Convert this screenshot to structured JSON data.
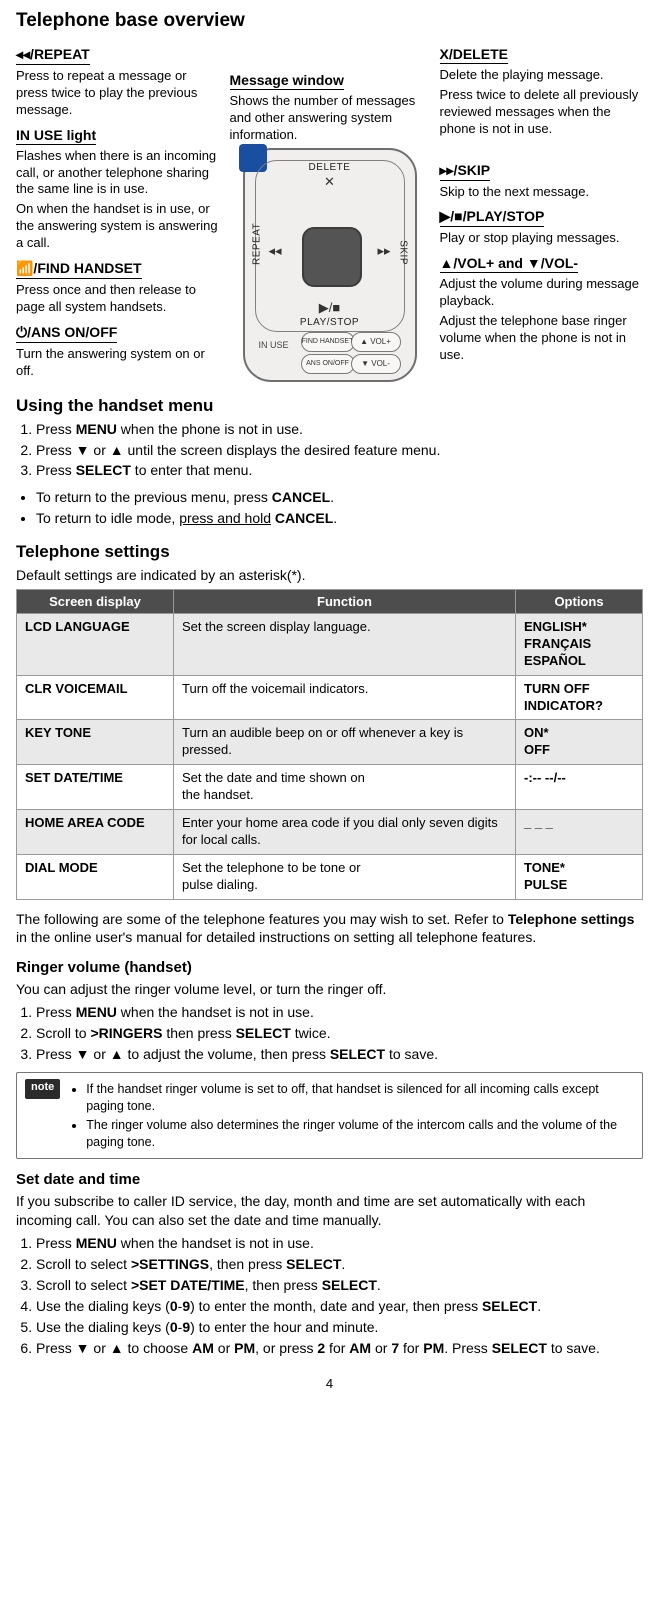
{
  "page_number": "4",
  "title": "Telephone base overview",
  "overview": {
    "left": {
      "repeat": {
        "title": "◂◂/REPEAT",
        "text": "Press to repeat a message or press twice to play the previous message."
      },
      "inuse": {
        "title": "IN USE light",
        "text1": "Flashes when there is an incoming call, or another telephone sharing the same line is in use.",
        "text2": "On when the handset is in use, or the answering system is answering a call."
      },
      "find": {
        "title": "📶/FIND HANDSET",
        "text": "Press once and then release to page all system handsets."
      },
      "ans": {
        "title": "⏻/ANS ON/OFF",
        "text": "Turn the answering system on or off."
      }
    },
    "center": {
      "msgwin": {
        "title": "Message window",
        "text": "Shows the number of messages and other answering system information."
      },
      "labels": {
        "delete": "DELETE",
        "repeat": "REPEAT",
        "skip": "SKIP",
        "play": "PLAY/STOP",
        "inuse": "IN USE",
        "find": "FIND\nHANDSET",
        "ans": "ANS\nON/OFF",
        "vplus": "▲ VOL+",
        "vminus": "▼ VOL-",
        "x": "✕",
        "left": "◂◂",
        "right": "▸▸",
        "playicon": "▶/■"
      }
    },
    "right": {
      "xdel": {
        "title": "X/DELETE",
        "text1": "Delete the playing message.",
        "text2": "Press twice to delete all previously reviewed messages when the phone is not in use."
      },
      "skip": {
        "title": "▸▸/SKIP",
        "text": "Skip to the next message."
      },
      "playstop": {
        "title": "▶/■/PLAY/STOP",
        "text": "Play or stop playing messages."
      },
      "vol": {
        "title": "▲/VOL+ and ▼/VOL-",
        "text1": "Adjust the volume during message playback.",
        "text2": "Adjust the telephone base ringer volume when the phone is not in use."
      }
    }
  },
  "using_menu": {
    "title": "Using the handset menu",
    "steps": [
      {
        "pre": "Press ",
        "bold": "MENU",
        "post": " when the phone is not in use."
      },
      {
        "pre": "Press ▼ or ▲ until the screen displays the desired feature menu.",
        "bold": "",
        "post": ""
      },
      {
        "pre": "Press ",
        "bold": "SELECT",
        "post": " to enter that menu."
      }
    ],
    "bullets": [
      {
        "pre": "To return to the previous menu, press ",
        "bold": "CANCEL",
        "post": "."
      },
      {
        "pre": "To return to idle mode, ",
        "u": "press and hold",
        "bold": " CANCEL",
        "post": "."
      }
    ]
  },
  "telephone_settings": {
    "title": "Telephone settings",
    "subtitle": "Default settings are indicated by an asterisk(*).",
    "headers": {
      "c1": "Screen display",
      "c2": "Function",
      "c3": "Options"
    },
    "rows": [
      {
        "c1": "LCD LANGUAGE",
        "c2": "Set the screen display language.",
        "c3": "ENGLISH*\nFRANÇAIS\nESPAÑOL"
      },
      {
        "c1": "CLR VOICEMAIL",
        "c2": "Turn off the voicemail indicators.",
        "c3": "TURN OFF INDICATOR?"
      },
      {
        "c1": "KEY TONE",
        "c2": "Turn an audible beep on or off whenever a key is pressed.",
        "c3": "ON*\nOFF"
      },
      {
        "c1": "SET DATE/TIME",
        "c2": "Set the date and time shown on\nthe handset.",
        "c3": "-:-- --/--"
      },
      {
        "c1": "HOME AREA CODE",
        "c2": "Enter your home area code if you dial only seven digits for local calls.",
        "c3": "_ _ _"
      },
      {
        "c1": "DIAL MODE",
        "c2": "Set the telephone to be tone or\npulse dialing.",
        "c3": "TONE*\nPULSE"
      }
    ],
    "after": {
      "p1": "The following are some of the telephone features you may wish to set. Refer to ",
      "b": "Telephone settings",
      "p2": " in the online user's manual for detailed instructions on setting all telephone features."
    }
  },
  "ringer": {
    "title": "Ringer volume (handset)",
    "intro": "You can adjust the ringer volume level, or turn the ringer off.",
    "steps": [
      {
        "pre": "Press ",
        "b": "MENU",
        "post": " when the handset is not in use."
      },
      {
        "pre": "Scroll to ",
        "b": ">RINGERS",
        "mid": " then press ",
        "b2": "SELECT",
        "post": " twice."
      },
      {
        "pre": "Press ▼ or ▲ to adjust the volume, then press ",
        "b": "SELECT",
        "post": " to save."
      }
    ],
    "note_label": "note",
    "notes": [
      "If the handset ringer volume is set to off, that handset is silenced for all incoming calls except paging tone.",
      "The ringer volume also determines the ringer volume of the intercom calls and the volume of the paging tone."
    ]
  },
  "datetime": {
    "title": "Set date and time",
    "intro": "If you subscribe to caller ID service, the day, month and time are set automatically with each incoming call. You can also set the date and time manually.",
    "steps": [
      "Press MENU when the handset is not in use.",
      "Scroll to select >SETTINGS, then press SELECT.",
      "Scroll to select >SET DATE/TIME, then press SELECT.",
      "Use the dialing keys (0-9) to enter the month, date and year, then press SELECT.",
      "Use the dialing keys (0-9) to enter the hour and minute.",
      "Press ▼ or ▲ to choose AM or PM, or press 2 for AM or 7 for PM. Press SELECT to save."
    ],
    "steps_html": [
      {
        "parts": [
          {
            "t": "Press "
          },
          {
            "b": "MENU"
          },
          {
            "t": " when the handset is not in use."
          }
        ]
      },
      {
        "parts": [
          {
            "t": "Scroll to select "
          },
          {
            "b": ">SETTINGS"
          },
          {
            "t": ", then press "
          },
          {
            "b": "SELECT"
          },
          {
            "t": "."
          }
        ]
      },
      {
        "parts": [
          {
            "t": "Scroll to select "
          },
          {
            "b": ">SET DATE/TIME"
          },
          {
            "t": ", then press "
          },
          {
            "b": "SELECT"
          },
          {
            "t": "."
          }
        ]
      },
      {
        "parts": [
          {
            "t": "Use the dialing keys ("
          },
          {
            "b": "0"
          },
          {
            "t": "-"
          },
          {
            "b": "9"
          },
          {
            "t": ") to enter the month, date and year, then press "
          },
          {
            "b": "SELECT"
          },
          {
            "t": "."
          }
        ]
      },
      {
        "parts": [
          {
            "t": "Use the dialing keys ("
          },
          {
            "b": "0"
          },
          {
            "t": "-"
          },
          {
            "b": "9"
          },
          {
            "t": ") to enter the hour and minute."
          }
        ]
      },
      {
        "parts": [
          {
            "t": "Press ▼ or ▲ to choose "
          },
          {
            "b": "AM"
          },
          {
            "t": " or "
          },
          {
            "b": "PM"
          },
          {
            "t": ", or press "
          },
          {
            "b": "2"
          },
          {
            "t": " for "
          },
          {
            "b": "AM"
          },
          {
            "t": " or "
          },
          {
            "b": "7"
          },
          {
            "t": " for "
          },
          {
            "b": "PM"
          },
          {
            "t": ". Press "
          },
          {
            "b": "SELECT"
          },
          {
            "t": " to save."
          }
        ]
      }
    ]
  }
}
